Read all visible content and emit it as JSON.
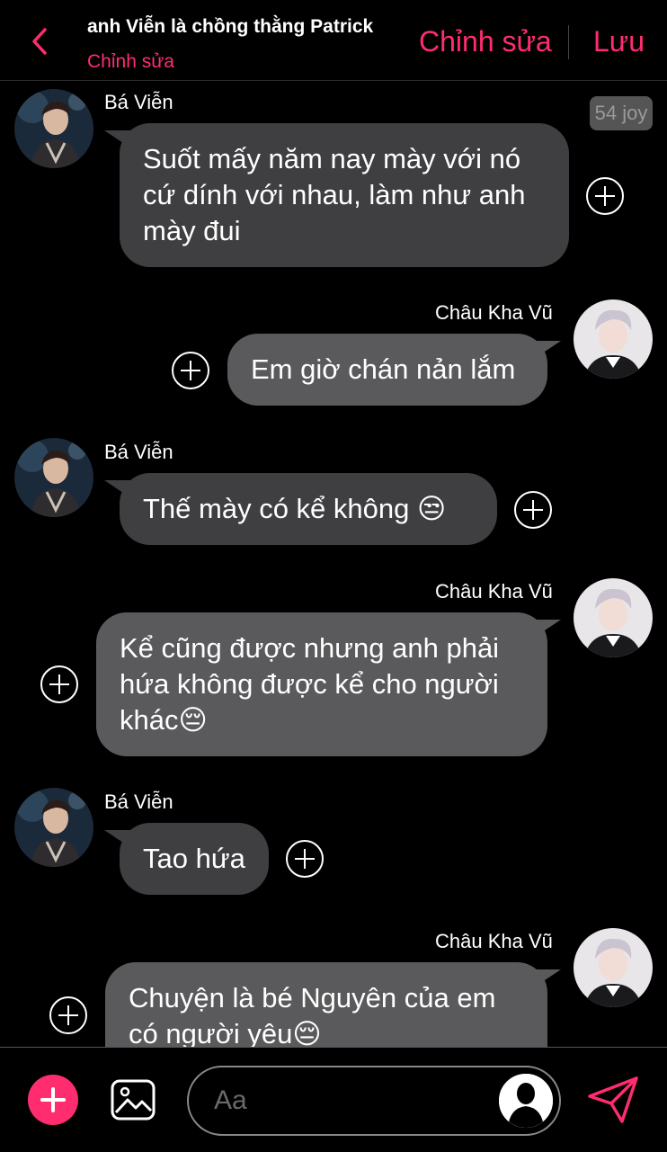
{
  "header": {
    "title": "anh Viễn là chồng thằng Patrick",
    "subtitle": "Chỉnh sửa",
    "edit_label": "Chỉnh sửa",
    "save_label": "Lưu"
  },
  "badge": {
    "text": "54 joy"
  },
  "messages": [
    {
      "sender": "Bá Viễn",
      "side": "left",
      "text": "Suốt mấy năm nay mày với nó cứ dính với nhau, làm như anh mày đui"
    },
    {
      "sender": "Châu Kha Vũ",
      "side": "right",
      "text": "Em giờ chán nản lắm"
    },
    {
      "sender": "Bá Viễn",
      "side": "left",
      "text": "Thế mày có kể không 😒"
    },
    {
      "sender": "Châu Kha Vũ",
      "side": "right",
      "text": "Kể cũng được nhưng anh phải hứa không được kể cho người khác😔"
    },
    {
      "sender": "Bá Viễn",
      "side": "left",
      "text": "Tao hứa"
    },
    {
      "sender": "Châu Kha Vũ",
      "side": "right",
      "text": "Chuyện là bé Nguyên của em có người yêu😔"
    }
  ],
  "composer": {
    "placeholder": "Aa"
  },
  "colors": {
    "accent": "#ff2d6f",
    "bubble_left": "#3f3f41",
    "bubble_right": "#5a5a5c",
    "background": "#000000"
  },
  "icons": {
    "back": "chevron-left-icon",
    "add": "plus-icon",
    "image": "image-icon",
    "send": "paper-plane-icon",
    "reaction": "plus-circle-icon",
    "character": "person-silhouette-icon"
  }
}
